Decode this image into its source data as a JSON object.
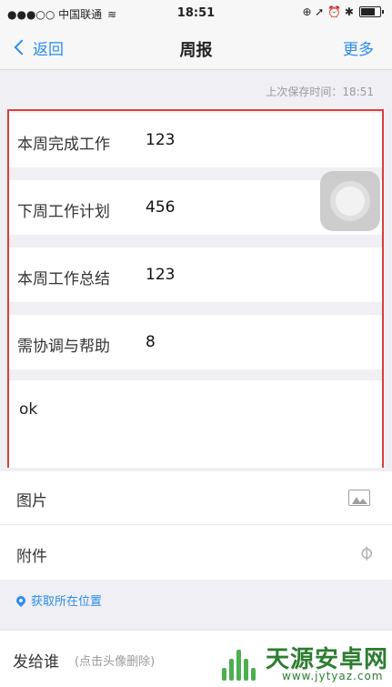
{
  "status_bar": {
    "carrier": "●●●○○ 中国联通",
    "wifi": "wifi-icon",
    "time": "18:51",
    "icons": "⊕ ➚ ⏰ ✱"
  },
  "nav": {
    "back_label": "返回",
    "title": "周报",
    "more_label": "更多"
  },
  "save_info": "上次保存时间：18:51",
  "form": {
    "fields": [
      {
        "label": "本周完成工作",
        "value": "123"
      },
      {
        "label": "下周工作计划",
        "value": "456"
      },
      {
        "label": "本周工作总结",
        "value": "123"
      },
      {
        "label": "需协调与帮助",
        "value": "8"
      }
    ],
    "notes": "ok"
  },
  "attachments": {
    "image_label": "图片",
    "image_icon": "image-icon",
    "file_label": "附件",
    "file_icon": "paperclip-icon"
  },
  "location_label": "获取所在位置",
  "send": {
    "label": "发给谁",
    "hint": "(点击头像删除)"
  },
  "watermark": {
    "title": "天源安卓网",
    "url": "www.jytyaz.com"
  },
  "colors": {
    "accent": "#2a8cf0",
    "highlight_border": "#d9403a"
  }
}
